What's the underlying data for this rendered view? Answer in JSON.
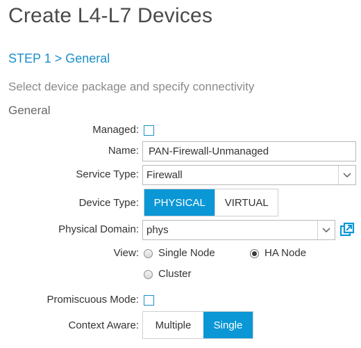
{
  "header": {
    "title": "Create L4-L7 Devices",
    "step": "STEP 1 > General",
    "subtitle": "Select device package and specify connectivity",
    "section": "General"
  },
  "form": {
    "managed": {
      "label": "Managed:",
      "checked": false
    },
    "name": {
      "label": "Name:",
      "value": "PAN-Firewall-Unmanaged"
    },
    "service_type": {
      "label": "Service Type:",
      "value": "Firewall"
    },
    "device_type": {
      "label": "Device Type:",
      "options": [
        "PHYSICAL",
        "VIRTUAL"
      ],
      "selected": "PHYSICAL"
    },
    "physical_domain": {
      "label": "Physical Domain:",
      "value": "phys"
    },
    "view": {
      "label": "View:",
      "options": [
        "Single Node",
        "HA Node",
        "Cluster"
      ],
      "selected": "HA Node"
    },
    "promiscuous_mode": {
      "label": "Promiscuous Mode:",
      "checked": false
    },
    "context_aware": {
      "label": "Context Aware:",
      "options": [
        "Multiple",
        "Single"
      ],
      "selected": "Single"
    }
  },
  "colors": {
    "accent": "#0b97d6",
    "link": "#1b8fc9",
    "text": "#333333",
    "muted": "#8a8a8a"
  },
  "icons": {
    "dropdown": "chevron-down-icon",
    "open_external": "open-external-icon"
  }
}
